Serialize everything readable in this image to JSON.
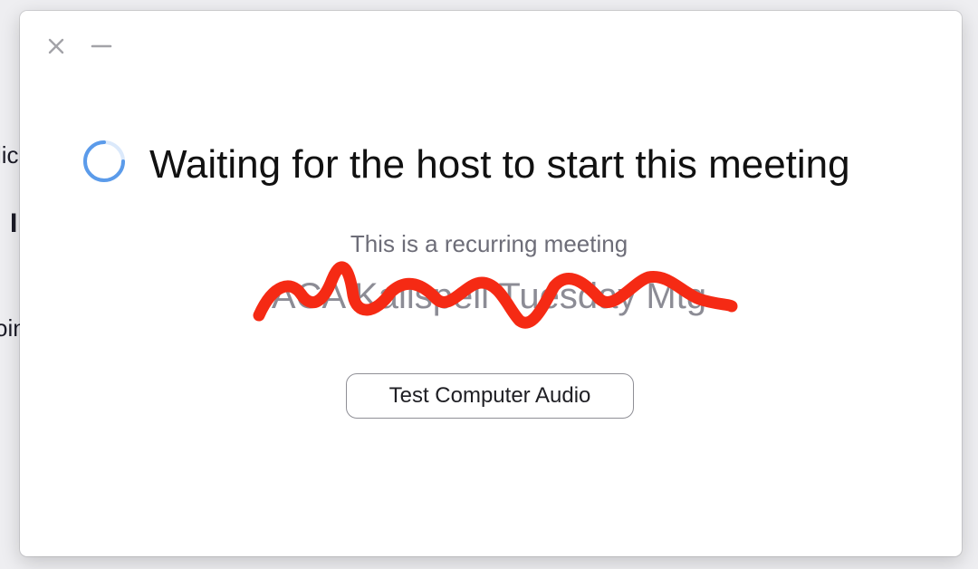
{
  "background": {
    "fragments": [
      "lic",
      "I",
      "oin"
    ]
  },
  "window": {
    "close_icon": "close-icon",
    "minimize_icon": "minimize-icon"
  },
  "status": {
    "spinner_icon": "loading-spinner-icon",
    "title": "Waiting for the host to start this meeting",
    "subtitle": "This is a recurring meeting",
    "meeting_name": "ACA Kalispell Tuesday Mtg"
  },
  "actions": {
    "test_audio_label": "Test Computer Audio"
  },
  "colors": {
    "spinner": "#5b9bea",
    "redaction": "#f52a14",
    "button_border": "#8f8f96"
  }
}
